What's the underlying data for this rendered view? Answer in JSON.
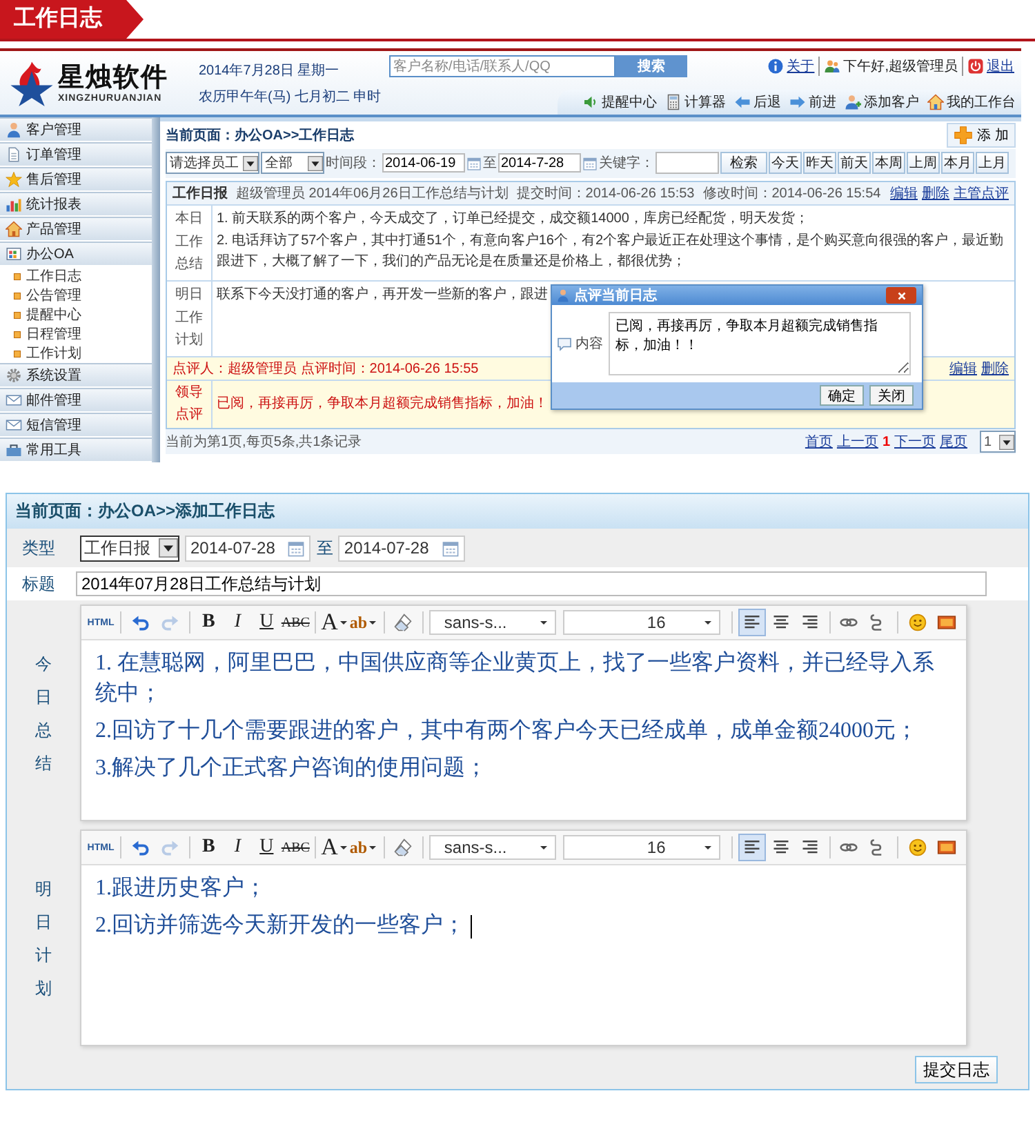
{
  "banner": {
    "title": "工作日志"
  },
  "app": {
    "logo": {
      "name": "星烛软件",
      "pinyin": "XINGZHURUANJIAN"
    },
    "date": "2014年7月28日 星期一",
    "lunar": "农历甲午年(马) 七月初二 申时",
    "search": {
      "placeholder": "客户名称/电话/联系人/QQ",
      "button": "搜索"
    },
    "user_links": [
      {
        "kind": "info",
        "label": "关于"
      },
      {
        "kind": "users",
        "label": "下午好,超级管理员"
      },
      {
        "kind": "exit",
        "label": "退出"
      }
    ],
    "toolbar": [
      {
        "kind": "speaker",
        "label": "提醒中心"
      },
      {
        "kind": "calculator",
        "label": "计算器"
      },
      {
        "kind": "back",
        "label": "后退"
      },
      {
        "kind": "forward",
        "label": "前进"
      },
      {
        "kind": "adduser",
        "label": "添加客户"
      },
      {
        "kind": "home",
        "label": "我的工作台"
      }
    ],
    "sidebar": {
      "items": [
        {
          "kind": "person",
          "label": "客户管理"
        },
        {
          "kind": "document",
          "label": "订单管理"
        },
        {
          "kind": "star",
          "label": "售后管理"
        },
        {
          "kind": "barchart",
          "label": "统计报表"
        },
        {
          "kind": "house",
          "label": "产品管理"
        },
        {
          "kind": "grid",
          "label": "办公OA",
          "children": [
            {
              "label": "工作日志"
            },
            {
              "label": "公告管理"
            },
            {
              "label": "提醒中心"
            },
            {
              "label": "日程管理"
            },
            {
              "label": "工作计划"
            }
          ]
        },
        {
          "kind": "gear",
          "label": "系统设置"
        },
        {
          "kind": "envelope",
          "label": "邮件管理"
        },
        {
          "kind": "envelope",
          "label": "短信管理"
        },
        {
          "kind": "toolbox",
          "label": "常用工具"
        }
      ]
    },
    "breadcrumb": "当前页面：办公OA>>工作日志",
    "add_button": "添 加",
    "filters": {
      "employee": "请选择员工",
      "scope": "全部",
      "period_label": "时间段：",
      "from": "2014-06-19",
      "to_label": "至",
      "to": "2014-7-28",
      "keyword_label": "关键字：",
      "search_button": "检索",
      "quick": [
        "今天",
        "昨天",
        "前天",
        "本周",
        "上周",
        "本月",
        "上月"
      ]
    },
    "log": {
      "type": "工作日报",
      "meta": [
        "超级管理员 2014年06月26日工作总结与计划",
        "提交时间：2014-06-26 15:53",
        "修改时间：2014-06-26 15:54"
      ],
      "actions": [
        "编辑",
        "删除",
        "主管点评"
      ],
      "sections": [
        {
          "label": "本日工作总结",
          "lines": [
            "1. 前天联系的两个客户，今天成交了，订单已经提交，成交额14000，库房已经配货，明天发货；",
            "2. 电话拜访了57个客户，其中打通51个，有意向客户16个，有2个客户最近正在处理这个事情，是个购买意向很强的客户，最近勤跟进下，大概了解了一下，我们的产品无论是在质量还是价格上，都很优势；"
          ]
        },
        {
          "label": "明日工作计划",
          "lines": [
            "联系下今天没打通的客户，再开发一些新的客户，跟进"
          ]
        }
      ],
      "review": {
        "meta": "点评人：超级管理员 点评时间：2014-06-26 15:55",
        "actions": [
          "编辑",
          "删除"
        ],
        "label": "领导点评",
        "text": "已阅，再接再厉，争取本月超额完成销售指标，加油！"
      }
    },
    "pagination": {
      "summary": "当前为第1页,每页5条,共1条记录",
      "before": [
        "首页",
        "上一页"
      ],
      "current": "1",
      "after": [
        "下一页",
        "尾页"
      ],
      "page_select": "1"
    },
    "dialog": {
      "title": "点评当前日志",
      "label": "内容",
      "value": "已阅，再接再厉，争取本月超额完成销售指标，加油！！",
      "buttons": [
        "确定",
        "关闭"
      ]
    }
  },
  "form": {
    "breadcrumb": "当前页面：办公OA>>添加工作日志",
    "type_label": "类型",
    "type_value": "工作日报",
    "from": "2014-07-28",
    "to_label": "至",
    "to": "2014-07-28",
    "title_label": "标题",
    "title_value": "2014年07月28日工作总结与计划",
    "editors": [
      {
        "label": "今日总结",
        "toolbar": {
          "groups": [
            [
              {
                "kind": "html",
                "label": "HTML"
              }
            ],
            [
              {
                "kind": "undo"
              },
              {
                "kind": "redo"
              }
            ],
            [
              {
                "kind": "bold",
                "label": "B"
              },
              {
                "kind": "italic",
                "label": "I"
              },
              {
                "kind": "underline",
                "label": "U"
              },
              {
                "kind": "strike",
                "label": "ABC"
              }
            ],
            [
              {
                "kind": "color",
                "label": "A"
              },
              {
                "kind": "highlight",
                "label": "ab"
              }
            ],
            [
              {
                "kind": "eraser"
              }
            ]
          ],
          "font": "sans-s...",
          "size": "16",
          "align": [
            {
              "kind": "left",
              "selected": true
            },
            {
              "kind": "center",
              "selected": false
            },
            {
              "kind": "right",
              "selected": false
            }
          ],
          "extras": [
            [
              {
                "kind": "link"
              },
              {
                "kind": "unlink"
              }
            ],
            [
              {
                "kind": "smiley"
              },
              {
                "kind": "image"
              }
            ]
          ]
        },
        "paragraphs": [
          "1.  在慧聪网，阿里巴巴，中国供应商等企业黄页上，找了一些客户资料，并已经导入系统中；",
          "2.回访了十几个需要跟进的客户，其中有两个客户今天已经成单，成单金额24000元；",
          "3.解决了几个正式客户咨询的使用问题；"
        ]
      },
      {
        "label": "明日计划",
        "toolbar": {
          "groups": [
            [
              {
                "kind": "html",
                "label": "HTML"
              }
            ],
            [
              {
                "kind": "undo"
              },
              {
                "kind": "redo"
              }
            ],
            [
              {
                "kind": "bold",
                "label": "B"
              },
              {
                "kind": "italic",
                "label": "I"
              },
              {
                "kind": "underline",
                "label": "U"
              },
              {
                "kind": "strike",
                "label": "ABC"
              }
            ],
            [
              {
                "kind": "color",
                "label": "A"
              },
              {
                "kind": "highlight",
                "label": "ab"
              }
            ],
            [
              {
                "kind": "eraser"
              }
            ]
          ],
          "font": "sans-s...",
          "size": "16",
          "align": [
            {
              "kind": "left",
              "selected": true
            },
            {
              "kind": "center",
              "selected": false
            },
            {
              "kind": "right",
              "selected": false
            }
          ],
          "extras": [
            [
              {
                "kind": "link"
              },
              {
                "kind": "unlink"
              }
            ],
            [
              {
                "kind": "smiley"
              },
              {
                "kind": "image"
              }
            ]
          ]
        },
        "paragraphs": [
          "1.跟进历史客户；",
          "2.回访并筛选今天新开发的一些客户；"
        ],
        "caret": true
      }
    ],
    "submit": "提交日志"
  }
}
